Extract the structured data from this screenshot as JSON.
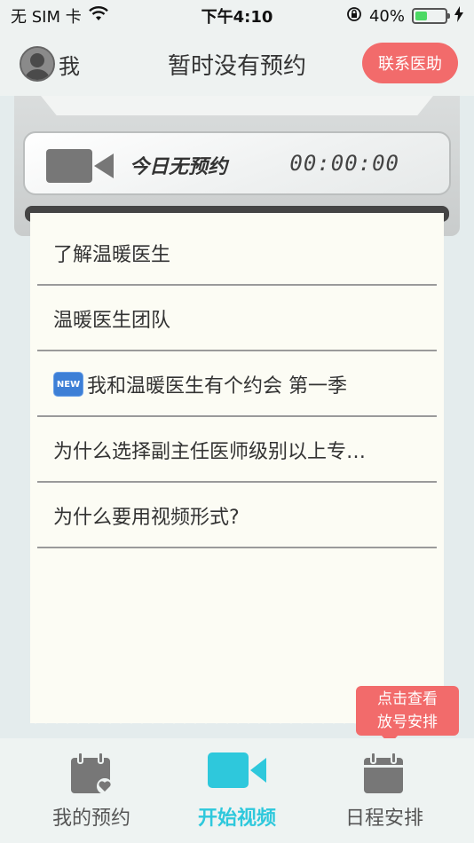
{
  "status_bar": {
    "carrier": "无 SIM 卡",
    "time": "下午4:10",
    "battery_percent": "40%",
    "battery_level": 0.4,
    "icons": [
      "wifi-icon",
      "rotation-lock-icon",
      "battery-icon",
      "charging-icon"
    ]
  },
  "header": {
    "me_label": "我",
    "title": "暂时没有预约",
    "contact_button": "联系医助"
  },
  "display": {
    "status_text": "今日无预约",
    "timer": "00:00:00"
  },
  "list": {
    "new_badge": "NEW",
    "items": [
      "了解温暖医生",
      "温暖医生团队",
      "我和温暖医生有个约会 第一季",
      "为什么选择副主任医师级别以上专…",
      "为什么要用视频形式?"
    ]
  },
  "tooltip": {
    "line1": "点击查看",
    "line2": "放号安排"
  },
  "tabs": [
    {
      "label": "我的预约",
      "icon": "calendar-heart-icon",
      "active": false
    },
    {
      "label": "开始视频",
      "icon": "video-camera-icon",
      "active": true
    },
    {
      "label": "日程安排",
      "icon": "calendar-icon",
      "active": false
    }
  ],
  "colors": {
    "accent_red": "#f26b6b",
    "active_tab": "#2ec8dc",
    "background": "#e4eced",
    "paper": "#fcfcf4"
  }
}
